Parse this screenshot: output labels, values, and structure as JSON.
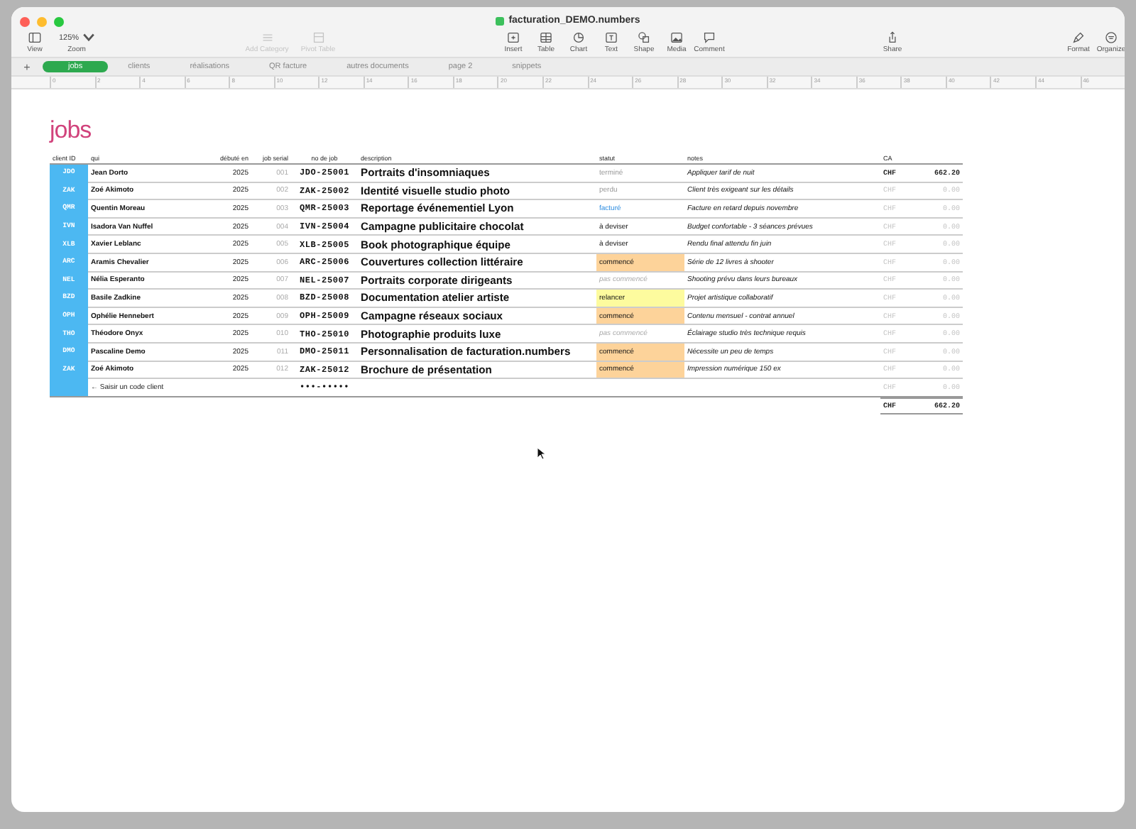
{
  "window": {
    "title": "facturation_DEMO.numbers"
  },
  "toolbar": {
    "zoom": "125%",
    "items": [
      {
        "label": "View",
        "disabled": false
      },
      {
        "label": "Zoom",
        "disabled": false
      },
      {
        "label": "Add Category",
        "disabled": true
      },
      {
        "label": "Pivot Table",
        "disabled": true
      },
      {
        "label": "Insert",
        "disabled": false
      },
      {
        "label": "Table",
        "disabled": false
      },
      {
        "label": "Chart",
        "disabled": false
      },
      {
        "label": "Text",
        "disabled": false
      },
      {
        "label": "Shape",
        "disabled": false
      },
      {
        "label": "Media",
        "disabled": false
      },
      {
        "label": "Comment",
        "disabled": false
      },
      {
        "label": "Share",
        "disabled": false
      },
      {
        "label": "Format",
        "disabled": false
      },
      {
        "label": "Organize",
        "disabled": false
      }
    ]
  },
  "add_sheet": "+",
  "tabs": [
    {
      "label": "jobs",
      "selected": true
    },
    {
      "label": "clients",
      "selected": false
    },
    {
      "label": "réalisations",
      "selected": false
    },
    {
      "label": "QR facture",
      "selected": false
    },
    {
      "label": "autres documents",
      "selected": false
    },
    {
      "label": "page 2",
      "selected": false
    },
    {
      "label": "snippets",
      "selected": false
    }
  ],
  "ruler": [
    "0",
    "2",
    "4",
    "6",
    "8",
    "10",
    "12",
    "14",
    "16",
    "18",
    "20",
    "22",
    "24",
    "26",
    "28",
    "30",
    "32",
    "34",
    "36",
    "38",
    "40",
    "42",
    "44",
    "46"
  ],
  "sheet_title": "jobs",
  "table": {
    "columns": [
      "client ID",
      "qui",
      "débuté en",
      "job serial",
      "no de job",
      "description",
      "statut",
      "notes",
      "CA"
    ],
    "rows": [
      {
        "client_id": "JDO",
        "qui": "Jean Dorto",
        "debut": "2025",
        "serial": "001",
        "job": "JDO-25001",
        "description": "Portraits d'insomniaques",
        "statut": "terminé",
        "kind": "done",
        "notes": "Appliquer tarif de nuit",
        "currency": "CHF",
        "amount": "662.20",
        "muted": false
      },
      {
        "client_id": "ZAK",
        "qui": "Zoé Akimoto",
        "debut": "2025",
        "serial": "002",
        "job": "ZAK-25002",
        "description": "Identité visuelle studio photo",
        "statut": "perdu",
        "kind": "done",
        "notes": "Client très exigeant sur les détails",
        "currency": "CHF",
        "amount": "0.00",
        "muted": true
      },
      {
        "client_id": "QMR",
        "qui": "Quentin Moreau",
        "debut": "2025",
        "serial": "003",
        "job": "QMR-25003",
        "description": "Reportage événementiel Lyon",
        "statut": "facturé",
        "kind": "billed",
        "notes": "Facture en retard depuis novembre",
        "currency": "CHF",
        "amount": "0.00",
        "muted": true
      },
      {
        "client_id": "IVN",
        "qui": "Isadora Van Nuffel",
        "debut": "2025",
        "serial": "004",
        "job": "IVN-25004",
        "description": "Campagne publicitaire chocolat",
        "statut": "à deviser",
        "kind": "quote",
        "notes": "Budget confortable - 3 séances prévues",
        "currency": "CHF",
        "amount": "0.00",
        "muted": true
      },
      {
        "client_id": "XLB",
        "qui": "Xavier Leblanc",
        "debut": "2025",
        "serial": "005",
        "job": "XLB-25005",
        "description": "Book photographique équipe",
        "statut": "à deviser",
        "kind": "quote",
        "notes": "Rendu final attendu fin juin",
        "currency": "CHF",
        "amount": "0.00",
        "muted": true
      },
      {
        "client_id": "ARC",
        "qui": "Aramis Chevalier",
        "debut": "2025",
        "serial": "006",
        "job": "ARC-25006",
        "description": "Couvertures collection littéraire",
        "statut": "commencé",
        "kind": "started",
        "notes": "Série de 12 livres à shooter",
        "currency": "CHF",
        "amount": "0.00",
        "muted": true
      },
      {
        "client_id": "NEL",
        "qui": "Nélia Esperanto",
        "debut": "2025",
        "serial": "007",
        "job": "NEL-25007",
        "description": "Portraits corporate dirigeants",
        "statut": "pas commencé",
        "kind": "todo",
        "notes": "Shooting prévu dans leurs bureaux",
        "currency": "CHF",
        "amount": "0.00",
        "muted": true
      },
      {
        "client_id": "BZD",
        "qui": "Basile Zadkine",
        "debut": "2025",
        "serial": "008",
        "job": "BZD-25008",
        "description": "Documentation atelier artiste",
        "statut": "relancer",
        "kind": "remind",
        "notes": "Projet artistique collaboratif",
        "currency": "CHF",
        "amount": "0.00",
        "muted": true
      },
      {
        "client_id": "OPH",
        "qui": "Ophélie Hennebert",
        "debut": "2025",
        "serial": "009",
        "job": "OPH-25009",
        "description": "Campagne réseaux sociaux",
        "statut": "commencé",
        "kind": "started",
        "notes": "Contenu mensuel - contrat annuel",
        "currency": "CHF",
        "amount": "0.00",
        "muted": true
      },
      {
        "client_id": "THO",
        "qui": "Théodore Onyx",
        "debut": "2025",
        "serial": "010",
        "job": "THO-25010",
        "description": "Photographie produits luxe",
        "statut": "pas commencé",
        "kind": "todo",
        "notes": "Éclairage studio très technique requis",
        "currency": "CHF",
        "amount": "0.00",
        "muted": true
      },
      {
        "client_id": "DMO",
        "qui": "Pascaline Demo",
        "debut": "2025",
        "serial": "011",
        "job": "DMO-25011",
        "description": "Personnalisation de facturation.numbers",
        "statut": "commencé",
        "kind": "started",
        "notes": "Nécessite un peu de temps",
        "currency": "CHF",
        "amount": "0.00",
        "muted": true
      },
      {
        "client_id": "ZAK",
        "qui": "Zoé Akimoto",
        "debut": "2025",
        "serial": "012",
        "job": "ZAK-25012",
        "description": "Brochure de présentation",
        "statut": "commencé",
        "kind": "started",
        "notes": "Impression numérique 150 ex",
        "currency": "CHF",
        "amount": "0.00",
        "muted": true
      }
    ],
    "entry_row": {
      "hint": "← Saisir un code client",
      "job": "•••-•••••",
      "currency": "CHF",
      "amount": "0.00"
    },
    "total": {
      "currency": "CHF",
      "amount": "662.20"
    }
  }
}
